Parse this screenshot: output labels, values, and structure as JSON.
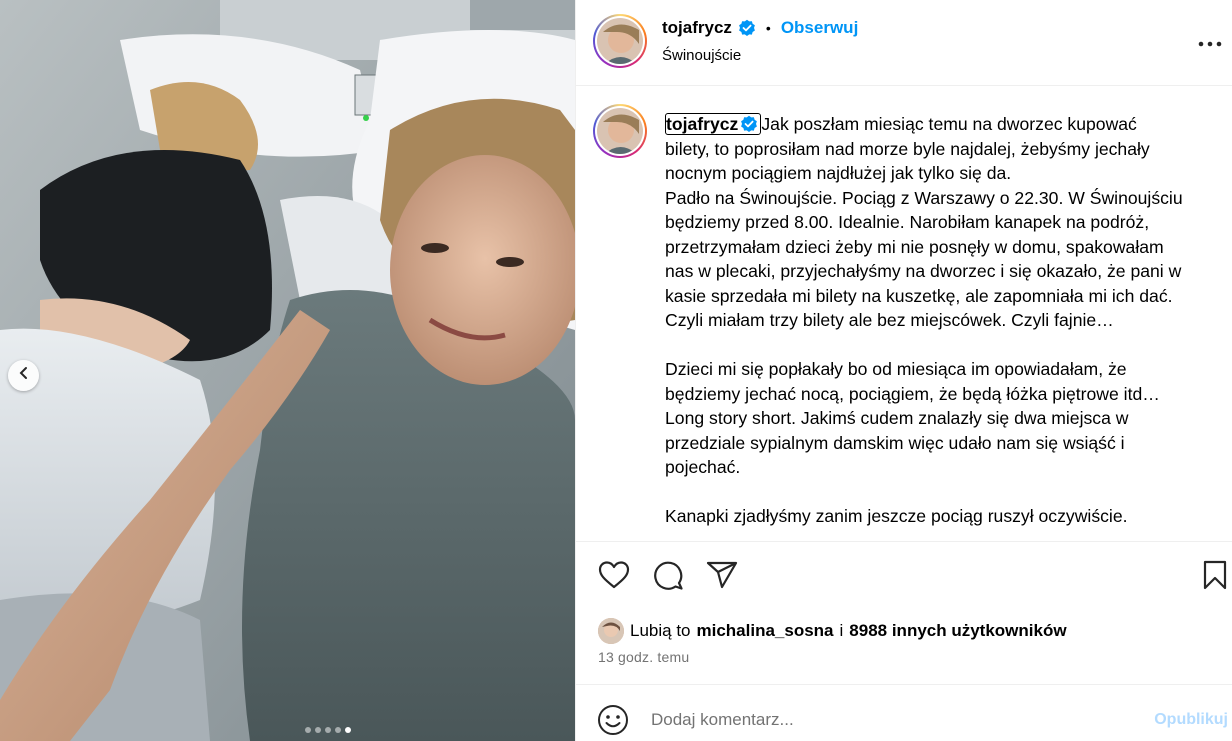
{
  "post": {
    "username": "tojafrycz",
    "follow_label": "Obserwuj",
    "bullet": "•",
    "location": "Świnoujście"
  },
  "caption": {
    "username": "tojafrycz",
    "paragraph1_lines": [
      "Jak poszłam miesiąc temu na dworzec kupować",
      "bilety, to poprosiłam nad morze byle najdalej, żebyśmy jechały",
      "nocnym pociągiem najdłużej jak tylko się da.",
      "Padło na Świnoujście. Pociąg z Warszawy o 22.30. W Świnoujściu",
      "będziemy przed 8.00. Idealnie. Narobiłam kanapek na podróż,",
      "przetrzymałam dzieci żeby mi nie posnęły w domu, spakowałam",
      "nas w plecaki, przyjechałyśmy na dworzec i się okazało, że pani w",
      "kasie sprzedała mi bilety na kuszetkę, ale zapomniała mi ich dać.",
      "Czyli miałam trzy bilety ale bez miejscówek. Czyli fajnie…"
    ],
    "paragraph2_lines": [
      "Dzieci mi się popłakały bo od miesiąca im opowiadałam, że",
      "będziemy jechać nocą, pociągiem, że będą łóżka piętrowe itd…",
      "Long story short. Jakimś cudem znalazły się dwa miejsca w",
      "przedziale sypialnym damskim więc udało nam się wsiąść i",
      "pojechać."
    ],
    "paragraph3_lines": [
      "Kanapki zjadłyśmy zanim jeszcze pociąg ruszył oczywiście."
    ]
  },
  "likes": {
    "prefix": "Lubią to",
    "first_user": "michalina_sosna",
    "connector": "i",
    "others": "8988 innych użytkowników"
  },
  "timestamp": "13 godz. temu",
  "comment": {
    "placeholder": "Dodaj komentarz...",
    "publish_label": "Opublikuj"
  },
  "carousel": {
    "total": 5,
    "active_index": 4
  },
  "colors": {
    "accent": "#0095f6",
    "publish_disabled": "#b3dbff",
    "muted": "#737373",
    "divider": "#efefef"
  },
  "icons": {
    "verified": "verified-badge-icon",
    "more": "more-options-icon",
    "like": "heart-icon",
    "comment": "comment-icon",
    "share": "paper-plane-icon",
    "save": "bookmark-icon",
    "emoji": "emoji-icon",
    "prev": "chevron-left-icon"
  }
}
